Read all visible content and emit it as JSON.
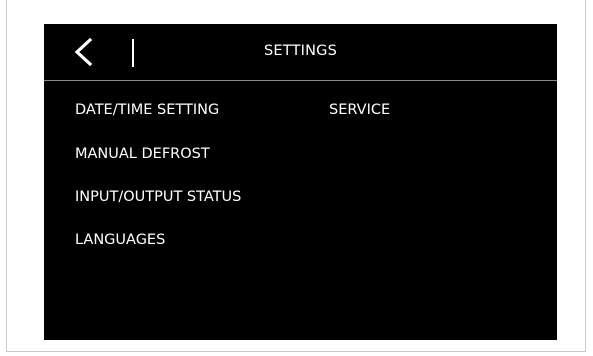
{
  "header": {
    "title": "SETTINGS",
    "back_icon": "chevron-left-icon"
  },
  "menu": {
    "left_column": [
      {
        "label": "DATE/TIME SETTING"
      },
      {
        "label": "MANUAL DEFROST"
      },
      {
        "label": "INPUT/OUTPUT STATUS"
      },
      {
        "label": "LANGUAGES"
      }
    ],
    "right_column": [
      {
        "label": "SERVICE"
      }
    ]
  },
  "colors": {
    "screen_background": "#000000",
    "text": "#ffffff",
    "header_rule": "#8c8c8c",
    "frame_border": "#c9c9c9"
  }
}
